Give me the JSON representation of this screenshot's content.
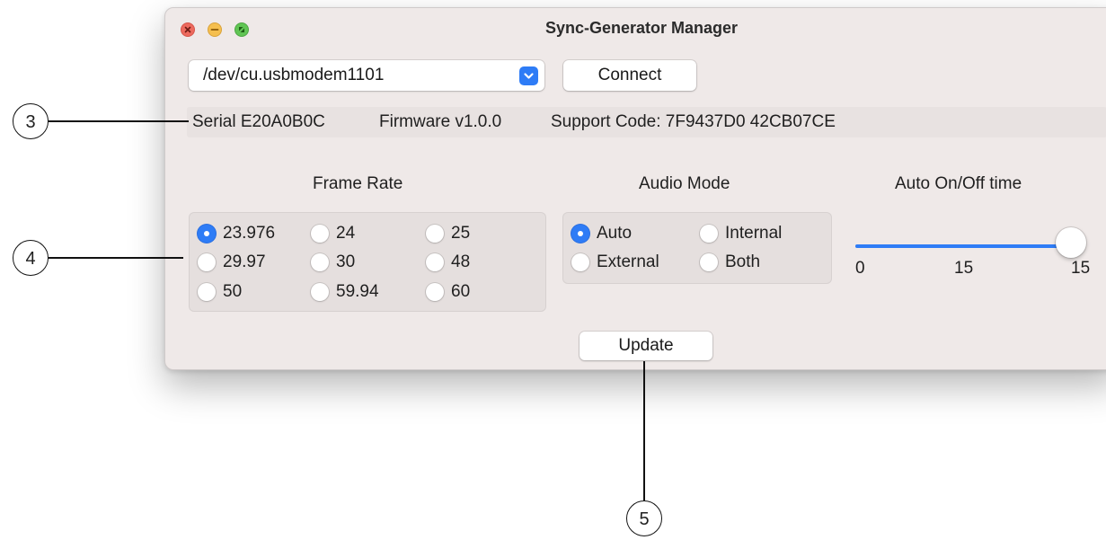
{
  "window": {
    "title": "Sync-Generator Manager"
  },
  "port": {
    "value": "/dev/cu.usbmodem1101"
  },
  "connect_label": "Connect",
  "info": {
    "serial": "Serial E20A0B0C",
    "firmware": "Firmware v1.0.0",
    "support": "Support Code: 7F9437D0 42CB07CE"
  },
  "frame_rate": {
    "heading": "Frame Rate",
    "options": [
      "23.976",
      "24",
      "25",
      "29.97",
      "30",
      "48",
      "50",
      "59.94",
      "60"
    ],
    "selected": "23.976"
  },
  "audio_mode": {
    "heading": "Audio Mode",
    "options": [
      "Auto",
      "Internal",
      "External",
      "Both"
    ],
    "selected": "Auto"
  },
  "auto_time": {
    "heading": "Auto On/Off time",
    "min_label": "0",
    "mid_label": "15",
    "max_label": "15",
    "value_fraction": 1.0
  },
  "update_label": "Update",
  "callouts": [
    "3",
    "4",
    "5"
  ],
  "colors": {
    "accent": "#2e7cf6",
    "window_bg": "#efe9e8"
  }
}
